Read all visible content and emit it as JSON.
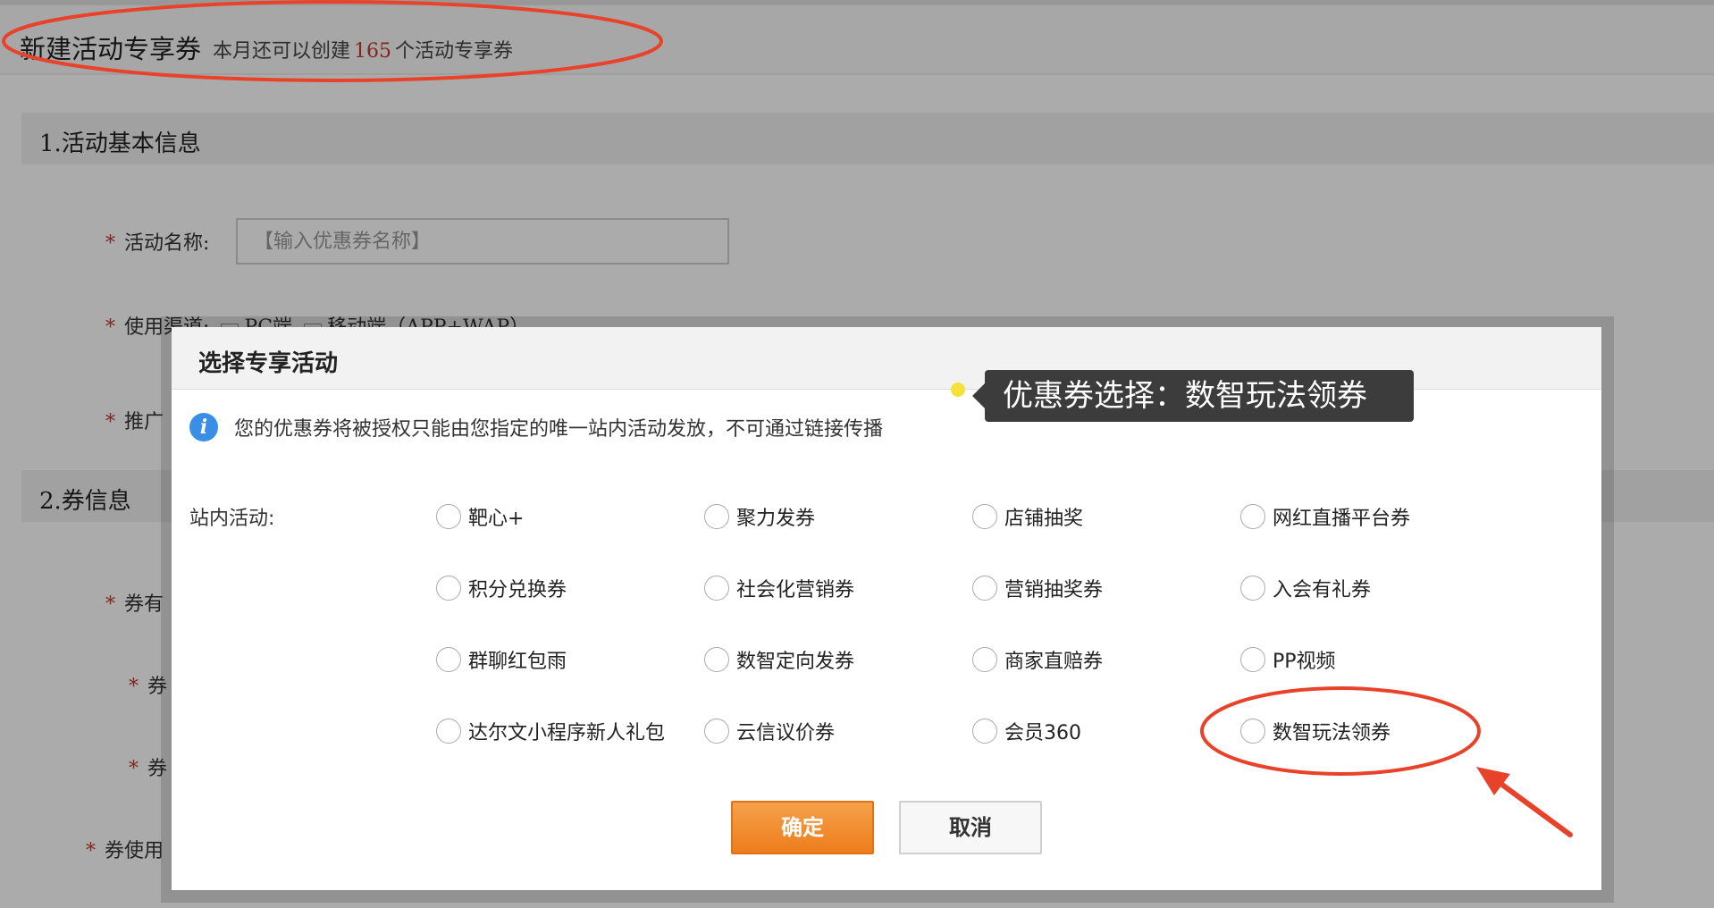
{
  "page": {
    "title": "新建活动专享券",
    "quota_prefix": "本月还可以创建",
    "quota_count": "165",
    "quota_suffix": "个活动专享券",
    "section1": "1.活动基本信息",
    "section2": "2.券信息",
    "required_mark": "*",
    "field_name_label": "活动名称:",
    "field_name_placeholder": "【输入优惠券名称】",
    "field_channel_label": "使用渠道:",
    "channel_pc": "PC端",
    "channel_mobile": "移动端（APP+WAP）",
    "field_promo_label": "推广",
    "field_valid_label": "券有",
    "field_coupon1_label": "券",
    "field_coupon2_label": "券",
    "field_usage_label": "券使用"
  },
  "modal": {
    "title": "选择专享活动",
    "notice": "您的优惠券将被授权只能由您指定的唯一站内活动发放，不可通过链接传播",
    "activity_label": "站内活动:",
    "options": [
      "靶心+",
      "聚力发券",
      "店铺抽奖",
      "网红直播平台券",
      "积分兑换券",
      "社会化营销券",
      "营销抽奖券",
      "入会有礼券",
      "群聊红包雨",
      "数智定向发券",
      "商家直赔券",
      "PP视频",
      "达尔文小程序新人礼包",
      "云信议价券",
      "会员360",
      "数智玩法领券"
    ],
    "confirm_label": "确定",
    "cancel_label": "取消"
  },
  "annotation": {
    "tooltip": "优惠券选择：数智玩法领券",
    "highlight_color": "#e8432a",
    "tooltip_dot_color": "#f5e13a"
  }
}
